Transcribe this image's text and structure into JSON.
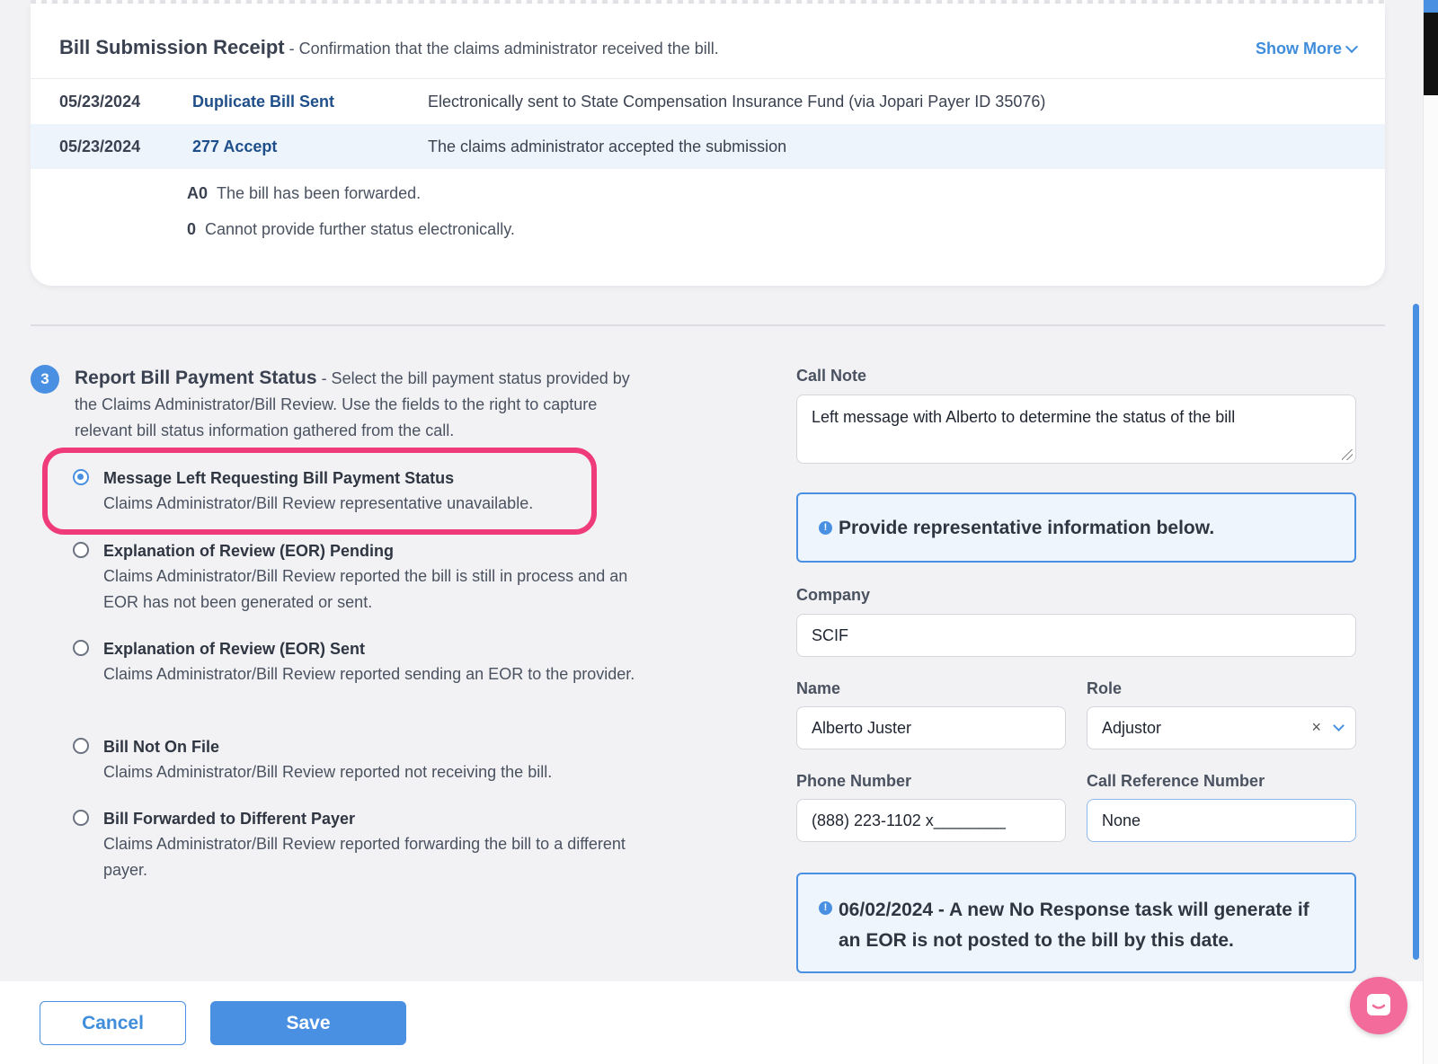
{
  "receipt": {
    "title": "Bill Submission Receipt",
    "subtitle": " - Confirmation that the claims administrator received the bill.",
    "show_more": "Show More",
    "rows": [
      {
        "date": "05/23/2024",
        "event": "Duplicate Bill Sent",
        "description": "Electronically sent to State Compensation Insurance Fund (via Jopari Payer ID 35076)"
      },
      {
        "date": "05/23/2024",
        "event": "277 Accept",
        "description": "The claims administrator accepted the submission"
      }
    ],
    "codes": [
      {
        "code": "A0",
        "text": "The bill has been forwarded."
      },
      {
        "code": "0",
        "text": "Cannot provide further status electronically."
      }
    ]
  },
  "report": {
    "step": "3",
    "title": "Report Bill Payment Status",
    "description": " - Select the bill payment status provided by the Claims Administrator/Bill Review. Use the fields to the right to capture relevant bill status information gathered from the call.",
    "options": [
      {
        "title": "Message Left Requesting Bill Payment Status",
        "desc": "Claims Administrator/Bill Review representative unavailable.",
        "checked": true
      },
      {
        "title": "Explanation of Review (EOR) Pending",
        "desc": "Claims Administrator/Bill Review reported the bill is still in process and an EOR has not been generated or sent.",
        "checked": false
      },
      {
        "title": "Explanation of Review (EOR) Sent",
        "desc": "Claims Administrator/Bill Review reported sending an EOR to the provider.",
        "checked": false
      },
      {
        "title": "Bill Not On File",
        "desc": "Claims Administrator/Bill Review reported not receiving the bill.",
        "checked": false
      },
      {
        "title": "Bill Forwarded to Different Payer",
        "desc": "Claims Administrator/Bill Review reported forwarding the bill to a different payer.",
        "checked": false
      }
    ]
  },
  "form": {
    "call_note_label": "Call Note",
    "call_note_value": "Left message with Alberto to determine the status of the bill",
    "rep_info": "Provide representative information below.",
    "company_label": "Company",
    "company_value": "SCIF",
    "name_label": "Name",
    "name_value": "Alberto Juster",
    "role_label": "Role",
    "role_value": "Adjustor",
    "phone_label": "Phone Number",
    "phone_value": "(888) 223-1102 x________",
    "callref_label": "Call Reference Number",
    "callref_value": "None",
    "notice": "06/02/2024 - A new No Response task will generate if an EOR is not posted to the bill by this date."
  },
  "footer": {
    "cancel": "Cancel",
    "save": "Save"
  },
  "colors": {
    "accent": "#4a90e2",
    "highlight": "#f03b7a",
    "chat": "#f26b9a"
  },
  "icons": {
    "info": "info-icon",
    "chevron": "chevron-down-icon",
    "clear": "close-icon",
    "chat": "chat-icon"
  }
}
